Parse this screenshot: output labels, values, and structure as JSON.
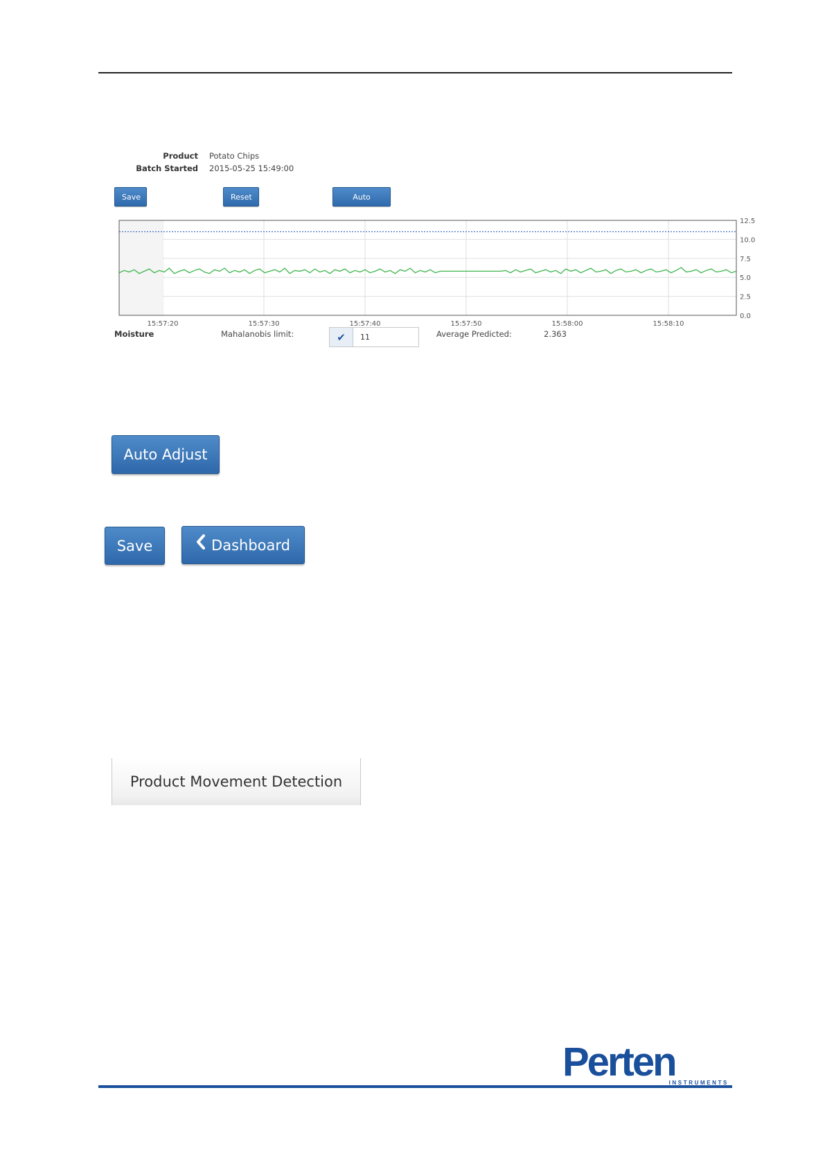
{
  "info": {
    "product_label": "Product",
    "product_value": "Potato Chips",
    "batch_label": "Batch Started",
    "batch_value": "2015-05-25 15:49:00"
  },
  "toolbar": {
    "save_label": "Save",
    "reset_label": "Reset",
    "auto_adjust_label": "Auto Adjust"
  },
  "chart_data": {
    "type": "line",
    "x_ticks": [
      "15:57:20",
      "15:57:30",
      "15:57:40",
      "15:57:50",
      "15:58:00",
      "15:58:10"
    ],
    "y_ticks": [
      "0.0",
      "2.5",
      "5.0",
      "7.5",
      "10.0",
      "12.5"
    ],
    "ylim": [
      0,
      12.5
    ],
    "grid": true,
    "limit_line": 11,
    "limit_color": "#3a66c4",
    "series": [
      {
        "color": "#3cb44b",
        "values": [
          5.6,
          5.9,
          5.7,
          6.0,
          5.5,
          5.8,
          6.1,
          5.6,
          5.9,
          5.7,
          6.2,
          5.5,
          5.8,
          6.0,
          5.6,
          5.9,
          6.1,
          5.7,
          5.5,
          6.0,
          5.8,
          6.2,
          5.6,
          5.9,
          5.7,
          6.0,
          5.5,
          5.9,
          6.1,
          5.6,
          5.8,
          6.0,
          5.7,
          6.2,
          5.5,
          5.9,
          5.8,
          6.0,
          5.6,
          6.1,
          5.7,
          5.9,
          5.5,
          6.0,
          5.8,
          6.1,
          5.6,
          5.9,
          5.7,
          6.0,
          5.6,
          5.8,
          6.1,
          5.7,
          5.9,
          5.5,
          6.0,
          5.8,
          6.2,
          5.6,
          5.9,
          5.7,
          6.0,
          5.6,
          5.8,
          5.8,
          5.8,
          5.8,
          5.8,
          5.8,
          5.8,
          5.8,
          5.8,
          5.8,
          5.8,
          5.8,
          5.8,
          5.9,
          5.6,
          6.0,
          5.7,
          5.9,
          6.1,
          5.6,
          5.8,
          6.0,
          5.7,
          5.9,
          5.5,
          6.1,
          5.8,
          6.0,
          5.6,
          5.9,
          6.2,
          5.7,
          5.8,
          6.0,
          5.5,
          5.9,
          6.1,
          5.7,
          5.8,
          6.0,
          5.6,
          5.9,
          6.1,
          5.7,
          5.8,
          6.0,
          5.6,
          5.9,
          6.3,
          5.7,
          5.8,
          6.0,
          5.6,
          5.9,
          6.1,
          5.7,
          5.8,
          6.0,
          5.6,
          5.8
        ]
      }
    ]
  },
  "moisture": {
    "label": "Moisture",
    "mahalanobis_label": "Mahalanobis limit:",
    "limit_value": "11",
    "average_label": "Average Predicted:",
    "average_value": "2.363"
  },
  "auto_adjust_large": "Auto Adjust",
  "nav": {
    "save_label": "Save",
    "dashboard_label": "Dashboard"
  },
  "tab": {
    "label": "Product Movement Detection"
  },
  "logo": {
    "main": "Perten",
    "sub": "INSTRUMENTS",
    "color": "#1a4f9c"
  }
}
